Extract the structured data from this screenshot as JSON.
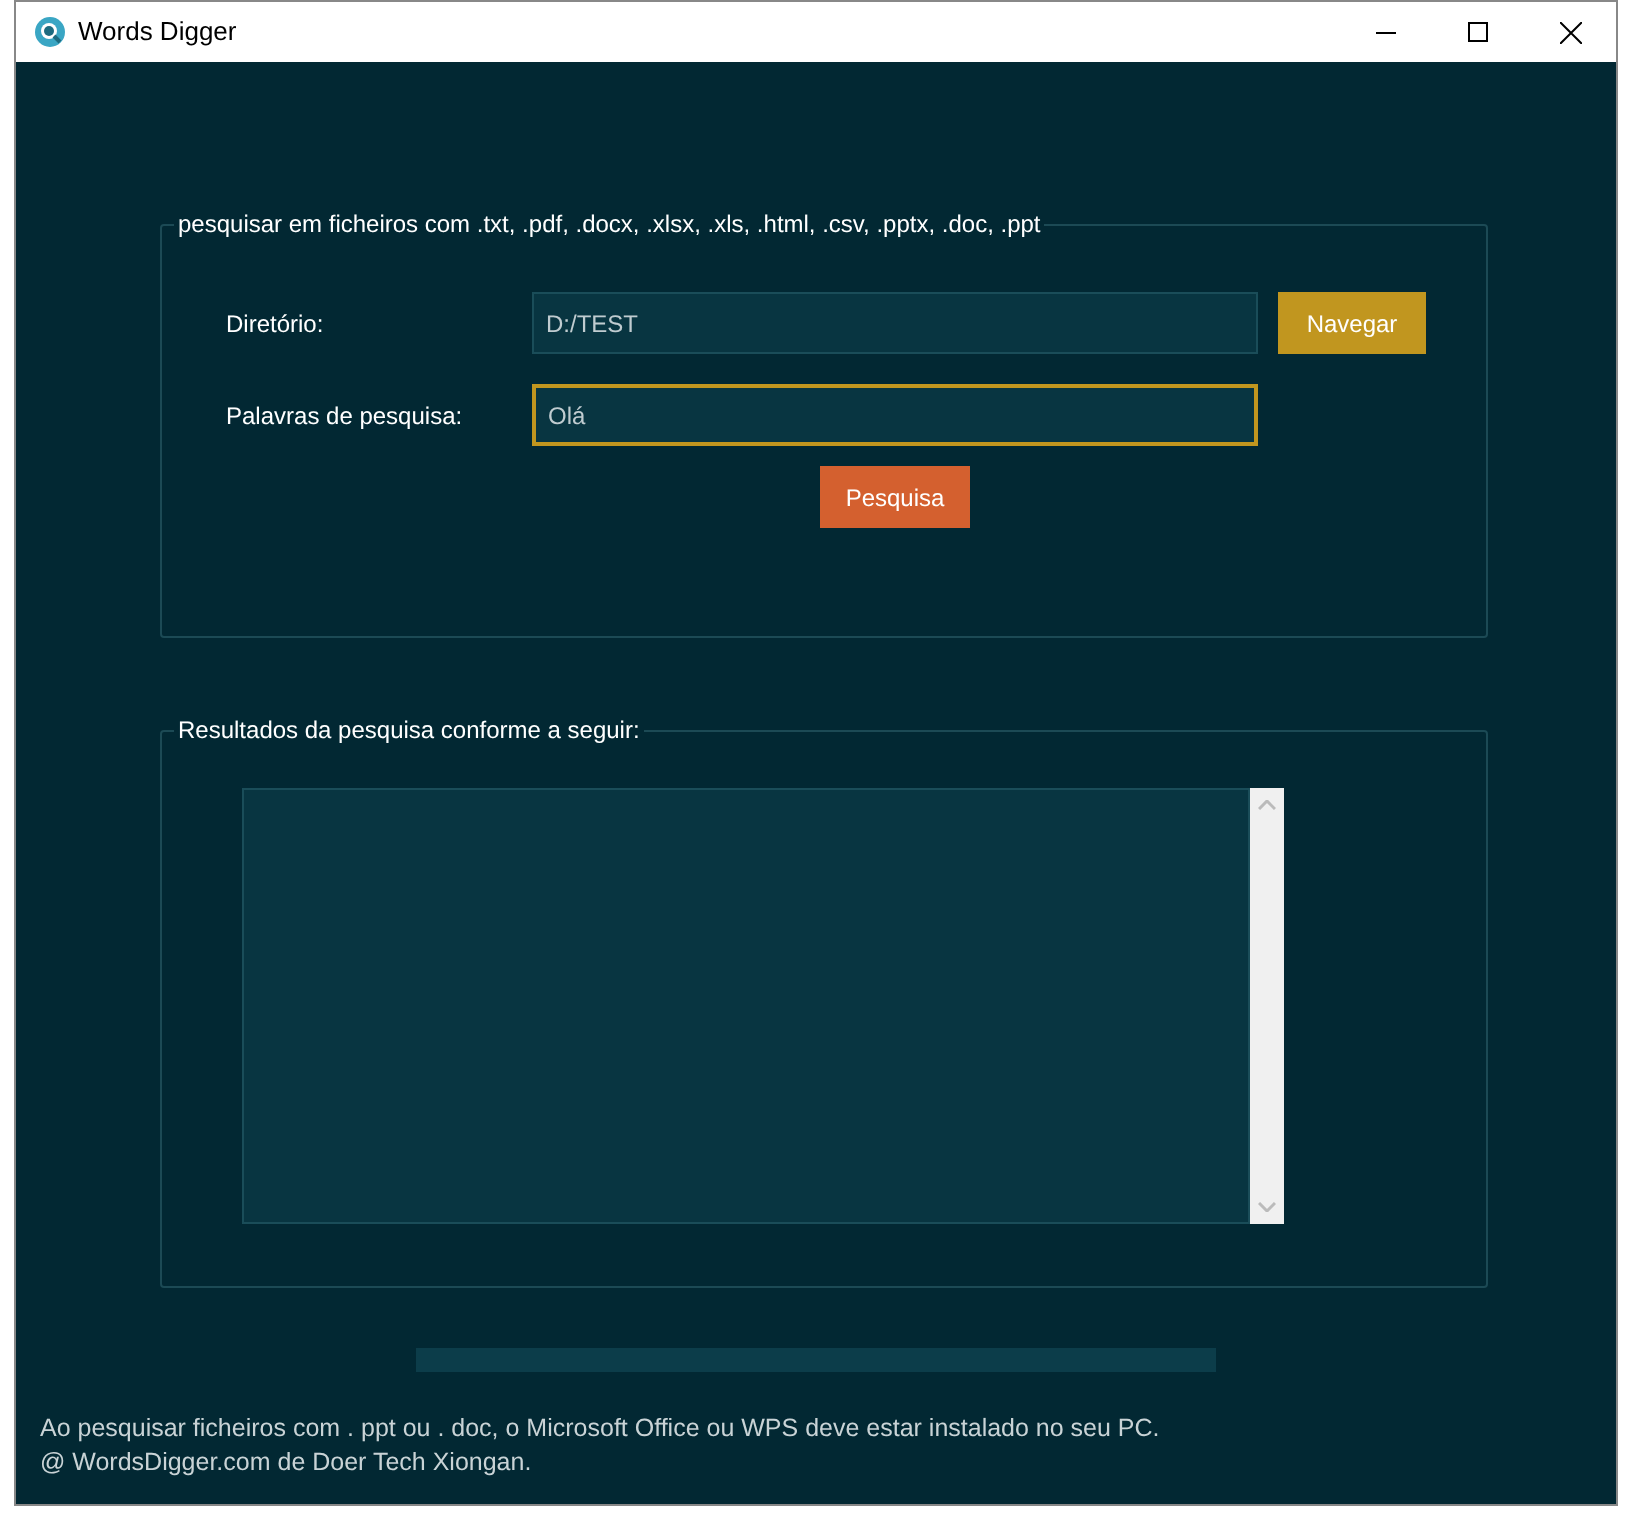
{
  "window": {
    "title": "Words Digger"
  },
  "search_group": {
    "legend": "pesquisar em ficheiros com .txt, .pdf, .docx, .xlsx, .xls, .html, .csv, .pptx, .doc, .ppt",
    "directory": {
      "label": "Diretório:",
      "value": "D:/TEST"
    },
    "browse_button": "Navegar",
    "keywords": {
      "label": "Palavras de pesquisa:",
      "value": "Olá",
      "focused": true
    },
    "search_button": "Pesquisa"
  },
  "results_group": {
    "legend": "Resultados da pesquisa conforme a seguir:"
  },
  "progress": {
    "level": 0
  },
  "footer": [
    "Ao pesquisar ficheiros com . ppt ou . doc, o Microsoft Office ou WPS deve estar instalado no seu PC.",
    "@ WordsDigger.com de Doer Tech Xiongan."
  ]
}
